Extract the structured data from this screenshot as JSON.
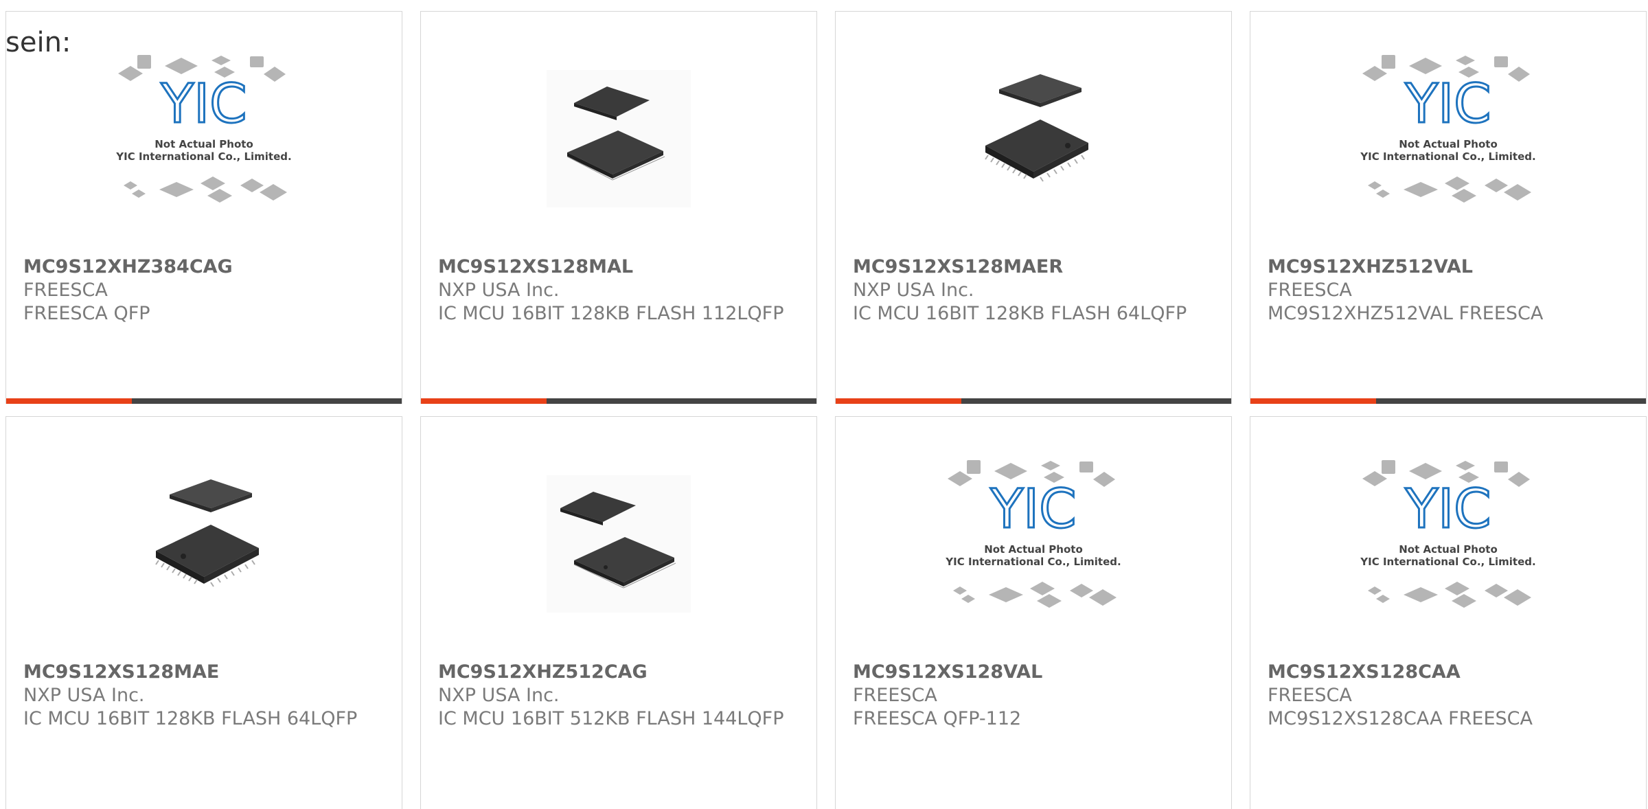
{
  "page": {
    "text_fragment": "sein:"
  },
  "placeholder": {
    "line1": "Not Actual Photo",
    "line2": "YIC International Co., Limited.",
    "logo_text": "YIC"
  },
  "colors": {
    "accent": "#e84118",
    "bar": "#444444",
    "text": "#7a7a7a",
    "logo": "#1e73be"
  },
  "products": [
    {
      "part_number": "MC9S12XHZ384CAG",
      "manufacturer": "FREESCA",
      "description": "FREESCA QFP",
      "image": "placeholder-logo"
    },
    {
      "part_number": "MC9S12XS128MAL",
      "manufacturer": "NXP USA Inc.",
      "description": "IC MCU 16BIT 128KB FLASH 112LQFP",
      "image": "lqfp-chip-flat"
    },
    {
      "part_number": "MC9S12XS128MAER",
      "manufacturer": "NXP USA Inc.",
      "description": "IC MCU 16BIT 128KB FLASH 64LQFP",
      "image": "lqfp-chip-pins"
    },
    {
      "part_number": "MC9S12XHZ512VAL",
      "manufacturer": "FREESCA",
      "description": "MC9S12XHZ512VAL FREESCA",
      "image": "placeholder-logo"
    },
    {
      "part_number": "MC9S12XS128MAE",
      "manufacturer": "NXP USA Inc.",
      "description": "IC MCU 16BIT 128KB FLASH 64LQFP",
      "image": "lqfp-chip-pins"
    },
    {
      "part_number": "MC9S12XHZ512CAG",
      "manufacturer": "NXP USA Inc.",
      "description": "IC MCU 16BIT 512KB FLASH 144LQFP",
      "image": "lqfp-chip-flat"
    },
    {
      "part_number": "MC9S12XS128VAL",
      "manufacturer": "FREESCA",
      "description": "FREESCA QFP-112",
      "image": "placeholder-logo"
    },
    {
      "part_number": "MC9S12XS128CAA",
      "manufacturer": "FREESCA",
      "description": "MC9S12XS128CAA FREESCA",
      "image": "placeholder-logo"
    }
  ]
}
